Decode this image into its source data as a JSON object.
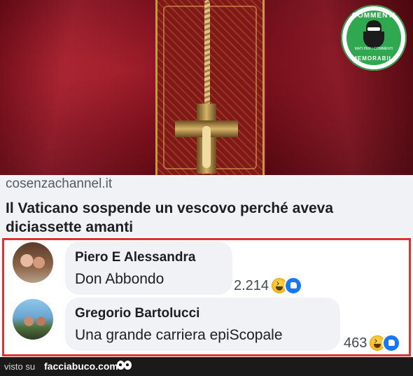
{
  "logo": {
    "top": "COMMENTI",
    "bottom": "MEMORABILI",
    "small": "MATI PER I COMMENTI"
  },
  "preview": {
    "domain": "cosenzachannel.it",
    "headline": "Il Vaticano sospende un vescovo perché aveva diciassette amanti"
  },
  "comments": [
    {
      "author": "Piero E Alessandra",
      "text": "Don Abbondo",
      "count": "2.214"
    },
    {
      "author": "Gregorio Bartolucci",
      "text": "Una grande carriera epiScopale",
      "count": "463"
    }
  ],
  "footer": {
    "visto_su": "visto su",
    "site": "facciabuco.com"
  },
  "colors": {
    "frame": "#e0332f",
    "like": "#1877f2",
    "haha": "#f7b928",
    "badge": "#2fa84f"
  },
  "icons": [
    "haha-reaction-icon",
    "like-reaction-icon",
    "eyes-icon"
  ]
}
